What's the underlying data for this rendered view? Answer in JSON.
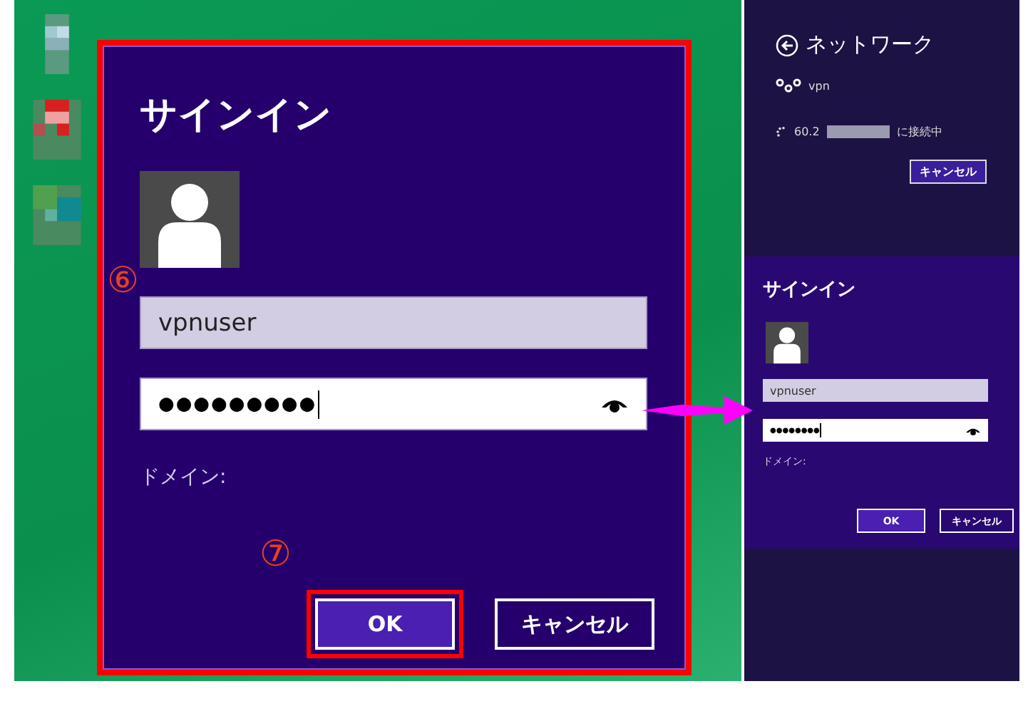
{
  "main_dialog": {
    "title": "サインイン",
    "username_marker": "⑥",
    "username": {
      "value": "vpnuser"
    },
    "password": {
      "value": "●●●●●●●●●"
    },
    "domain_label": "ドメイン:",
    "ok_marker": "⑦",
    "buttons": [
      {
        "label": "OK",
        "kind": "primary",
        "highlighted": true
      },
      {
        "label": "キャンセル",
        "kind": "secondary",
        "highlighted": false
      }
    ]
  },
  "network_panel": {
    "title": "ネットワーク",
    "connection": "vpn",
    "status_prefix": "60.2",
    "status_suffix": "に接続中",
    "cancel_button": "キャンセル"
  },
  "small_dialog": {
    "title": "サインイン",
    "username": {
      "value": "vpnuser"
    },
    "password": {
      "value": "●●●●●●●●"
    },
    "domain_label": "ドメイン:",
    "buttons": [
      {
        "label": "OK",
        "kind": "primary"
      },
      {
        "label": "キャンセル",
        "kind": "secondary"
      }
    ]
  }
}
